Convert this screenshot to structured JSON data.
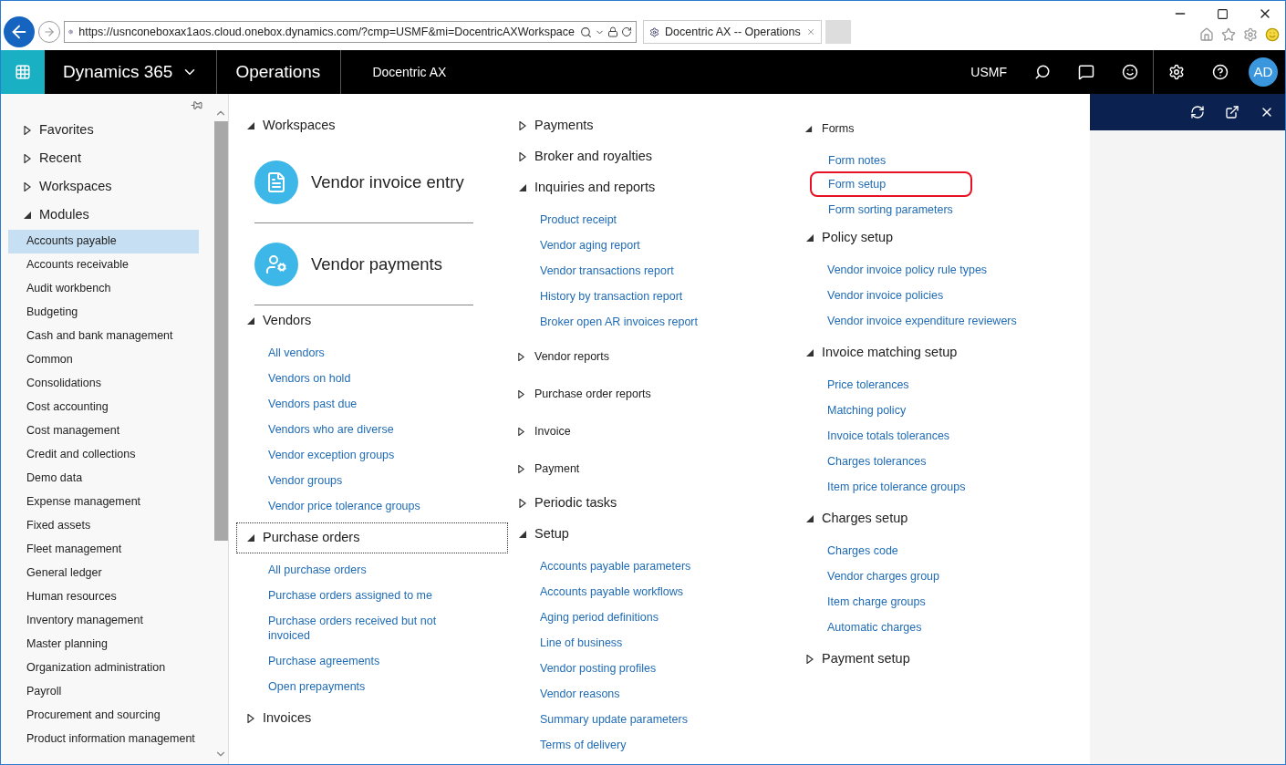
{
  "browser": {
    "url": "https://usnconeboxax1aos.cloud.onebox.dynamics.com/?cmp=USMF&mi=DocentricAXWorkspace",
    "tab_title": "Docentric AX -- Operations"
  },
  "navbar": {
    "product": "Dynamics 365",
    "app": "Operations",
    "workspace": "Docentric AX",
    "company": "USMF",
    "avatar": "AD"
  },
  "sidebar": {
    "groups": [
      {
        "label": "Favorites",
        "expanded": false
      },
      {
        "label": "Recent",
        "expanded": false
      },
      {
        "label": "Workspaces",
        "expanded": false
      },
      {
        "label": "Modules",
        "expanded": true,
        "items": [
          {
            "label": "Accounts payable",
            "selected": true
          },
          {
            "label": "Accounts receivable",
            "selected": false
          },
          {
            "label": "Audit workbench",
            "selected": false
          },
          {
            "label": "Budgeting",
            "selected": false
          },
          {
            "label": "Cash and bank management",
            "selected": false
          },
          {
            "label": "Common",
            "selected": false
          },
          {
            "label": "Consolidations",
            "selected": false
          },
          {
            "label": "Cost accounting",
            "selected": false
          },
          {
            "label": "Cost management",
            "selected": false
          },
          {
            "label": "Credit and collections",
            "selected": false
          },
          {
            "label": "Demo data",
            "selected": false
          },
          {
            "label": "Expense management",
            "selected": false
          },
          {
            "label": "Fixed assets",
            "selected": false
          },
          {
            "label": "Fleet management",
            "selected": false
          },
          {
            "label": "General ledger",
            "selected": false
          },
          {
            "label": "Human resources",
            "selected": false
          },
          {
            "label": "Inventory management",
            "selected": false
          },
          {
            "label": "Master planning",
            "selected": false
          },
          {
            "label": "Organization administration",
            "selected": false
          },
          {
            "label": "Payroll",
            "selected": false
          },
          {
            "label": "Procurement and sourcing",
            "selected": false
          },
          {
            "label": "Product information management",
            "selected": false
          }
        ]
      }
    ]
  },
  "columns": [
    [
      {
        "kind": "section",
        "title": "Workspaces",
        "expanded": true,
        "focused": false,
        "tiles": [
          {
            "label": "Vendor invoice entry"
          },
          {
            "label": "Vendor payments"
          }
        ]
      },
      {
        "kind": "section",
        "title": "Vendors",
        "expanded": true,
        "focused": false,
        "links": [
          {
            "label": "All vendors",
            "highlighted": false
          },
          {
            "label": "Vendors on hold",
            "highlighted": false
          },
          {
            "label": "Vendors past due",
            "highlighted": false
          },
          {
            "label": "Vendors who are diverse",
            "highlighted": false
          },
          {
            "label": "Vendor exception groups",
            "highlighted": false
          },
          {
            "label": "Vendor groups",
            "highlighted": false
          },
          {
            "label": "Vendor price tolerance groups",
            "highlighted": false
          }
        ]
      },
      {
        "kind": "section",
        "title": "Purchase orders",
        "expanded": true,
        "focused": true,
        "links": [
          {
            "label": "All purchase orders",
            "highlighted": false
          },
          {
            "label": "Purchase orders assigned to me",
            "highlighted": false
          },
          {
            "label": "Purchase orders received but not invoiced",
            "highlighted": false
          },
          {
            "label": "Purchase agreements",
            "highlighted": false
          },
          {
            "label": "Open prepayments",
            "highlighted": false
          }
        ]
      },
      {
        "kind": "section",
        "title": "Invoices",
        "expanded": false,
        "focused": false
      }
    ],
    [
      {
        "kind": "section",
        "title": "Payments",
        "expanded": false,
        "focused": false
      },
      {
        "kind": "section",
        "title": "Broker and royalties",
        "expanded": false,
        "focused": false
      },
      {
        "kind": "section",
        "title": "Inquiries and reports",
        "expanded": true,
        "focused": false,
        "links": [
          {
            "label": "Product receipt",
            "highlighted": false
          },
          {
            "label": "Vendor aging report",
            "highlighted": false
          },
          {
            "label": "Vendor transactions report",
            "highlighted": false
          },
          {
            "label": "History by transaction report",
            "highlighted": false
          },
          {
            "label": "Broker open AR invoices report",
            "highlighted": false
          }
        ]
      },
      {
        "kind": "subsection",
        "title": "Vendor reports",
        "expanded": false
      },
      {
        "kind": "subsection",
        "title": "Purchase order reports",
        "expanded": false
      },
      {
        "kind": "subsection",
        "title": "Invoice",
        "expanded": false
      },
      {
        "kind": "subsection",
        "title": "Payment",
        "expanded": false
      },
      {
        "kind": "section",
        "title": "Periodic tasks",
        "expanded": false,
        "focused": false
      },
      {
        "kind": "section",
        "title": "Setup",
        "expanded": true,
        "focused": false,
        "links": [
          {
            "label": "Accounts payable parameters",
            "highlighted": false
          },
          {
            "label": "Accounts payable workflows",
            "highlighted": false
          },
          {
            "label": "Aging period definitions",
            "highlighted": false
          },
          {
            "label": "Line of business",
            "highlighted": false
          },
          {
            "label": "Vendor posting profiles",
            "highlighted": false
          },
          {
            "label": "Vendor reasons",
            "highlighted": false
          },
          {
            "label": "Summary update parameters",
            "highlighted": false
          },
          {
            "label": "Terms of delivery",
            "highlighted": false
          }
        ]
      }
    ],
    [
      {
        "kind": "subsection",
        "title": "Forms",
        "expanded": true,
        "links": [
          {
            "label": "Form notes",
            "highlighted": false
          },
          {
            "label": "Form setup",
            "highlighted": true
          },
          {
            "label": "Form sorting parameters",
            "highlighted": false
          }
        ]
      },
      {
        "kind": "section",
        "title": "Policy setup",
        "expanded": true,
        "focused": false,
        "links": [
          {
            "label": "Vendor invoice policy rule types",
            "highlighted": false
          },
          {
            "label": "Vendor invoice policies",
            "highlighted": false
          },
          {
            "label": "Vendor invoice expenditure reviewers",
            "highlighted": false
          }
        ]
      },
      {
        "kind": "section",
        "title": "Invoice matching setup",
        "expanded": true,
        "focused": false,
        "links": [
          {
            "label": "Price tolerances",
            "highlighted": false
          },
          {
            "label": "Matching policy",
            "highlighted": false
          },
          {
            "label": "Invoice totals tolerances",
            "highlighted": false
          },
          {
            "label": "Charges tolerances",
            "highlighted": false
          },
          {
            "label": "Item price tolerance groups",
            "highlighted": false
          }
        ]
      },
      {
        "kind": "section",
        "title": "Charges setup",
        "expanded": true,
        "focused": false,
        "links": [
          {
            "label": "Charges code",
            "highlighted": false
          },
          {
            "label": "Vendor charges group",
            "highlighted": false
          },
          {
            "label": "Item charge groups",
            "highlighted": false
          },
          {
            "label": "Automatic charges",
            "highlighted": false
          }
        ]
      },
      {
        "kind": "section",
        "title": "Payment setup",
        "expanded": false,
        "focused": false
      }
    ]
  ]
}
